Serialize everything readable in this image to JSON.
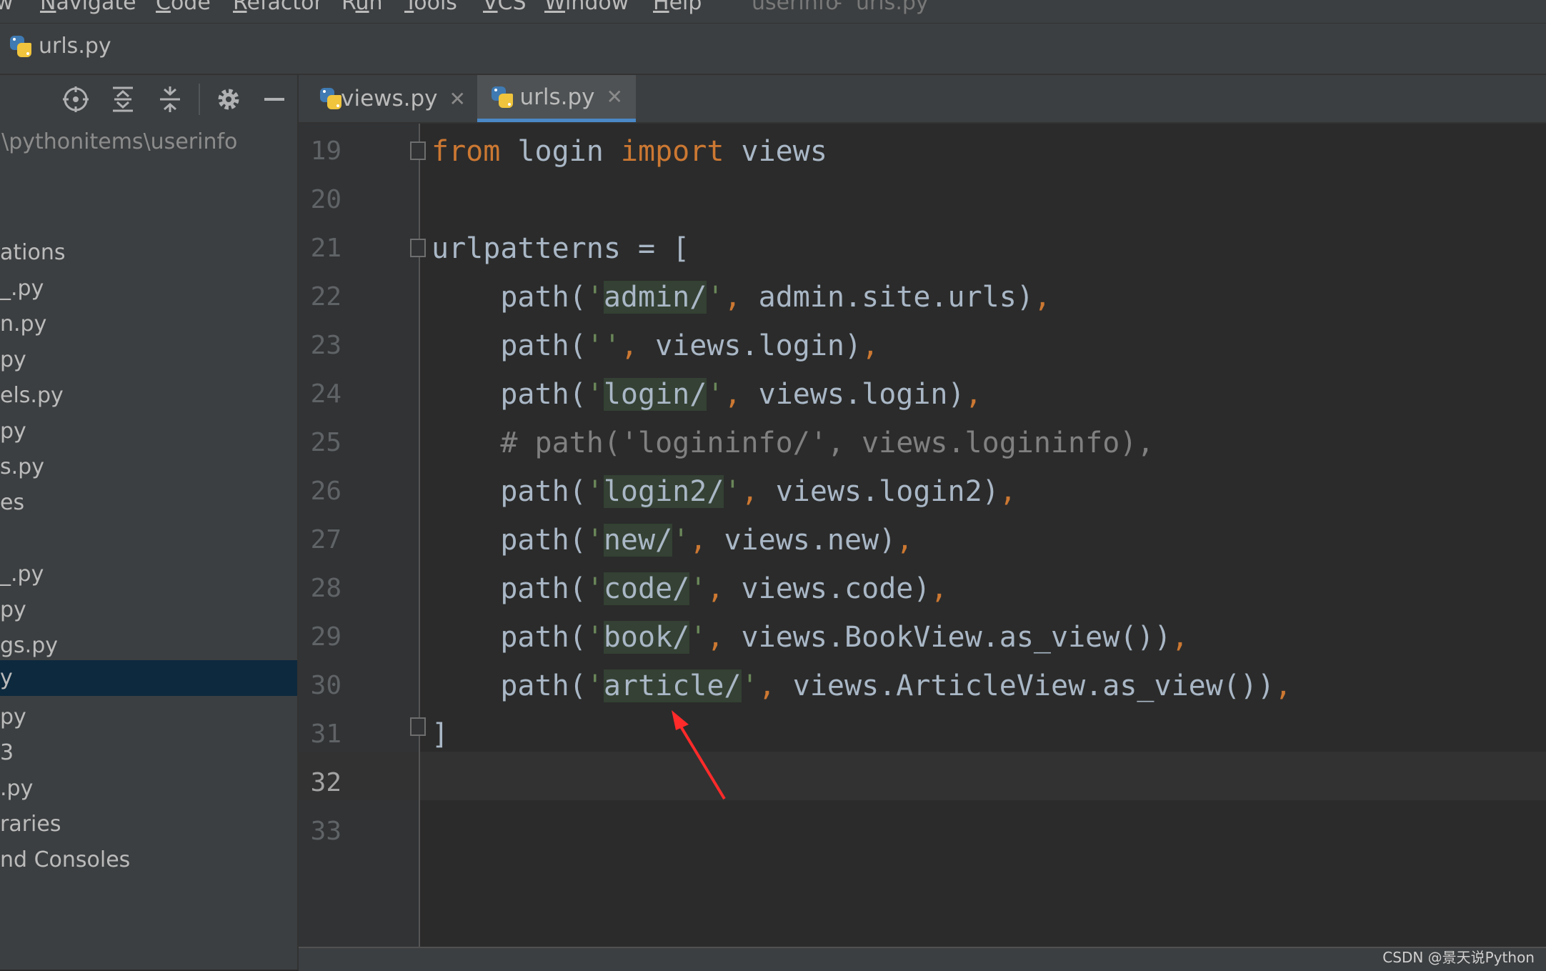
{
  "menubar": {
    "items": [
      "w",
      "Navigate",
      "Code",
      "Refactor",
      "Run",
      "Tools",
      "VCS",
      "Window",
      "Help"
    ],
    "mnemonics": [
      "",
      "N",
      "C",
      "R",
      "u",
      "T",
      "V",
      "W",
      "H"
    ],
    "project_title": "userinfo",
    "file_title": "urls.py"
  },
  "navbar": {
    "file": "urls.py"
  },
  "sidebar": {
    "path": ":\\pythonitems\\userinfo",
    "rows": [
      "ations",
      "_.py",
      "n.py",
      "py",
      "els.py",
      "py",
      "s.py",
      "es",
      "",
      "_.py",
      "py",
      "gs.py",
      "y",
      "py",
      "3",
      ".py",
      "raries",
      "nd Consoles"
    ],
    "selected_index": 12,
    "toolbar_icons": [
      "locate-icon",
      "expand-all-icon",
      "collapse-all-icon",
      "gear-icon",
      "hide-icon"
    ]
  },
  "tabs": [
    {
      "label": "views.py",
      "active": false
    },
    {
      "label": "urls.py",
      "active": true
    }
  ],
  "editor": {
    "current_line": "32",
    "lines": [
      {
        "no": "19",
        "text": "from login import views"
      },
      {
        "no": "20",
        "text": ""
      },
      {
        "no": "21",
        "text": "urlpatterns = ["
      },
      {
        "no": "22",
        "text": "    path('admin/', admin.site.urls),"
      },
      {
        "no": "23",
        "text": "    path('', views.login),"
      },
      {
        "no": "24",
        "text": "    path('login/', views.login),"
      },
      {
        "no": "25",
        "text": "    # path('logininfo/', views.logininfo),"
      },
      {
        "no": "26",
        "text": "    path('login2/', views.login2),"
      },
      {
        "no": "27",
        "text": "    path('new/', views.new),"
      },
      {
        "no": "28",
        "text": "    path('code/', views.code),"
      },
      {
        "no": "29",
        "text": "    path('book/', views.BookView.as_view()),"
      },
      {
        "no": "30",
        "text": "    path('article/', views.ArticleView.as_view()),"
      },
      {
        "no": "31",
        "text": "]"
      },
      {
        "no": "32",
        "text": ""
      },
      {
        "no": "33",
        "text": ""
      }
    ]
  },
  "annotation": {
    "arrow_color": "#ff2a2a"
  },
  "watermark": "CSDN @景天说Python",
  "colors": {
    "keyword": "#cc7832",
    "string": "#6a8759",
    "comment": "#808080",
    "accent": "#4a88c7",
    "selection": "#0d293e"
  }
}
